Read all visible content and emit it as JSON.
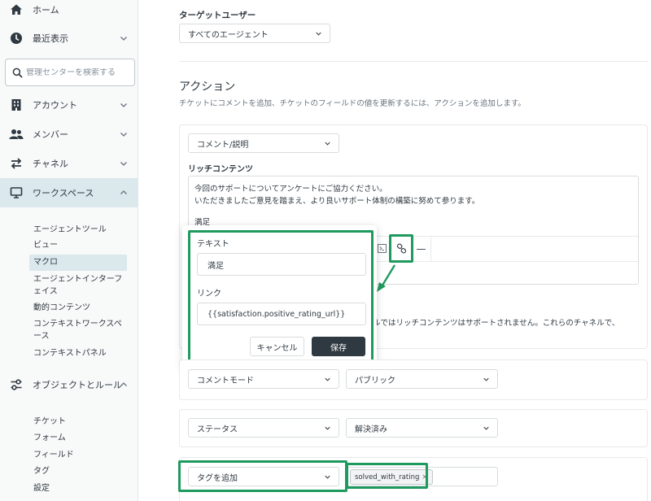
{
  "sidebar": {
    "home": "ホーム",
    "recent": "最近表示",
    "search_placeholder": "管理センターを検索する",
    "account": "アカウント",
    "members": "メンバー",
    "channels": "チャネル",
    "workspace": "ワークスペース",
    "workspace_items": [
      "エージェントツール",
      "ビュー",
      "マクロ",
      "エージェントインターフェイス",
      "動的コンテンツ",
      "コンテキストワークスペース",
      "コンテキストパネル"
    ],
    "objects_rules": "オブジェクトとルール",
    "objects_items": [
      "チケット",
      "フォーム",
      "フィールド",
      "タグ",
      "設定"
    ]
  },
  "target": {
    "label": "ターゲットユーザー",
    "value": "すべてのエージェント"
  },
  "actions": {
    "heading": "アクション",
    "description": "チケットにコメントを追加、チケットのフィールドの値を更新するには、アクションを追加します。",
    "comment_select": "コメント/説明",
    "rich_content_label": "リッチコンテンツ",
    "rich_text_line1": "今回のサポートについてアンケートにご協力ください。",
    "rich_text_line2": "いただきましたご意見を踏まえ、より良いサポート体制の構築に努めて参ります。",
    "rich_text_line3": "満足",
    "channel_note": "ルではリッチコンテンツはサポートされません。これらのチャネルで、",
    "comment_mode_select": "コメントモード",
    "comment_mode_value": "パブリック",
    "status_select": "ステータス",
    "status_value": "解決済み",
    "tag_select": "タグを追加",
    "tag_value": "solved_with_rating",
    "tag_remove": "×"
  },
  "link_popup": {
    "text_label": "テキスト",
    "text_value": "満足",
    "link_label": "リンク",
    "link_value": "{{satisfaction.positive_rating_url}}",
    "cancel": "キャンセル",
    "save": "保存"
  },
  "toolbar": {
    "hr_symbol": "—"
  },
  "colors": {
    "highlight": "#1f9a5e",
    "save_button": "#2f3941",
    "sidebar_active": "#dbe8ec"
  },
  "icons": [
    "home-icon",
    "clock-icon",
    "search-icon",
    "building-icon",
    "people-icon",
    "arrows-icon",
    "monitor-icon",
    "objects-icon",
    "chevron-down-icon",
    "chevron-up-icon",
    "link-icon",
    "code-icon"
  ]
}
